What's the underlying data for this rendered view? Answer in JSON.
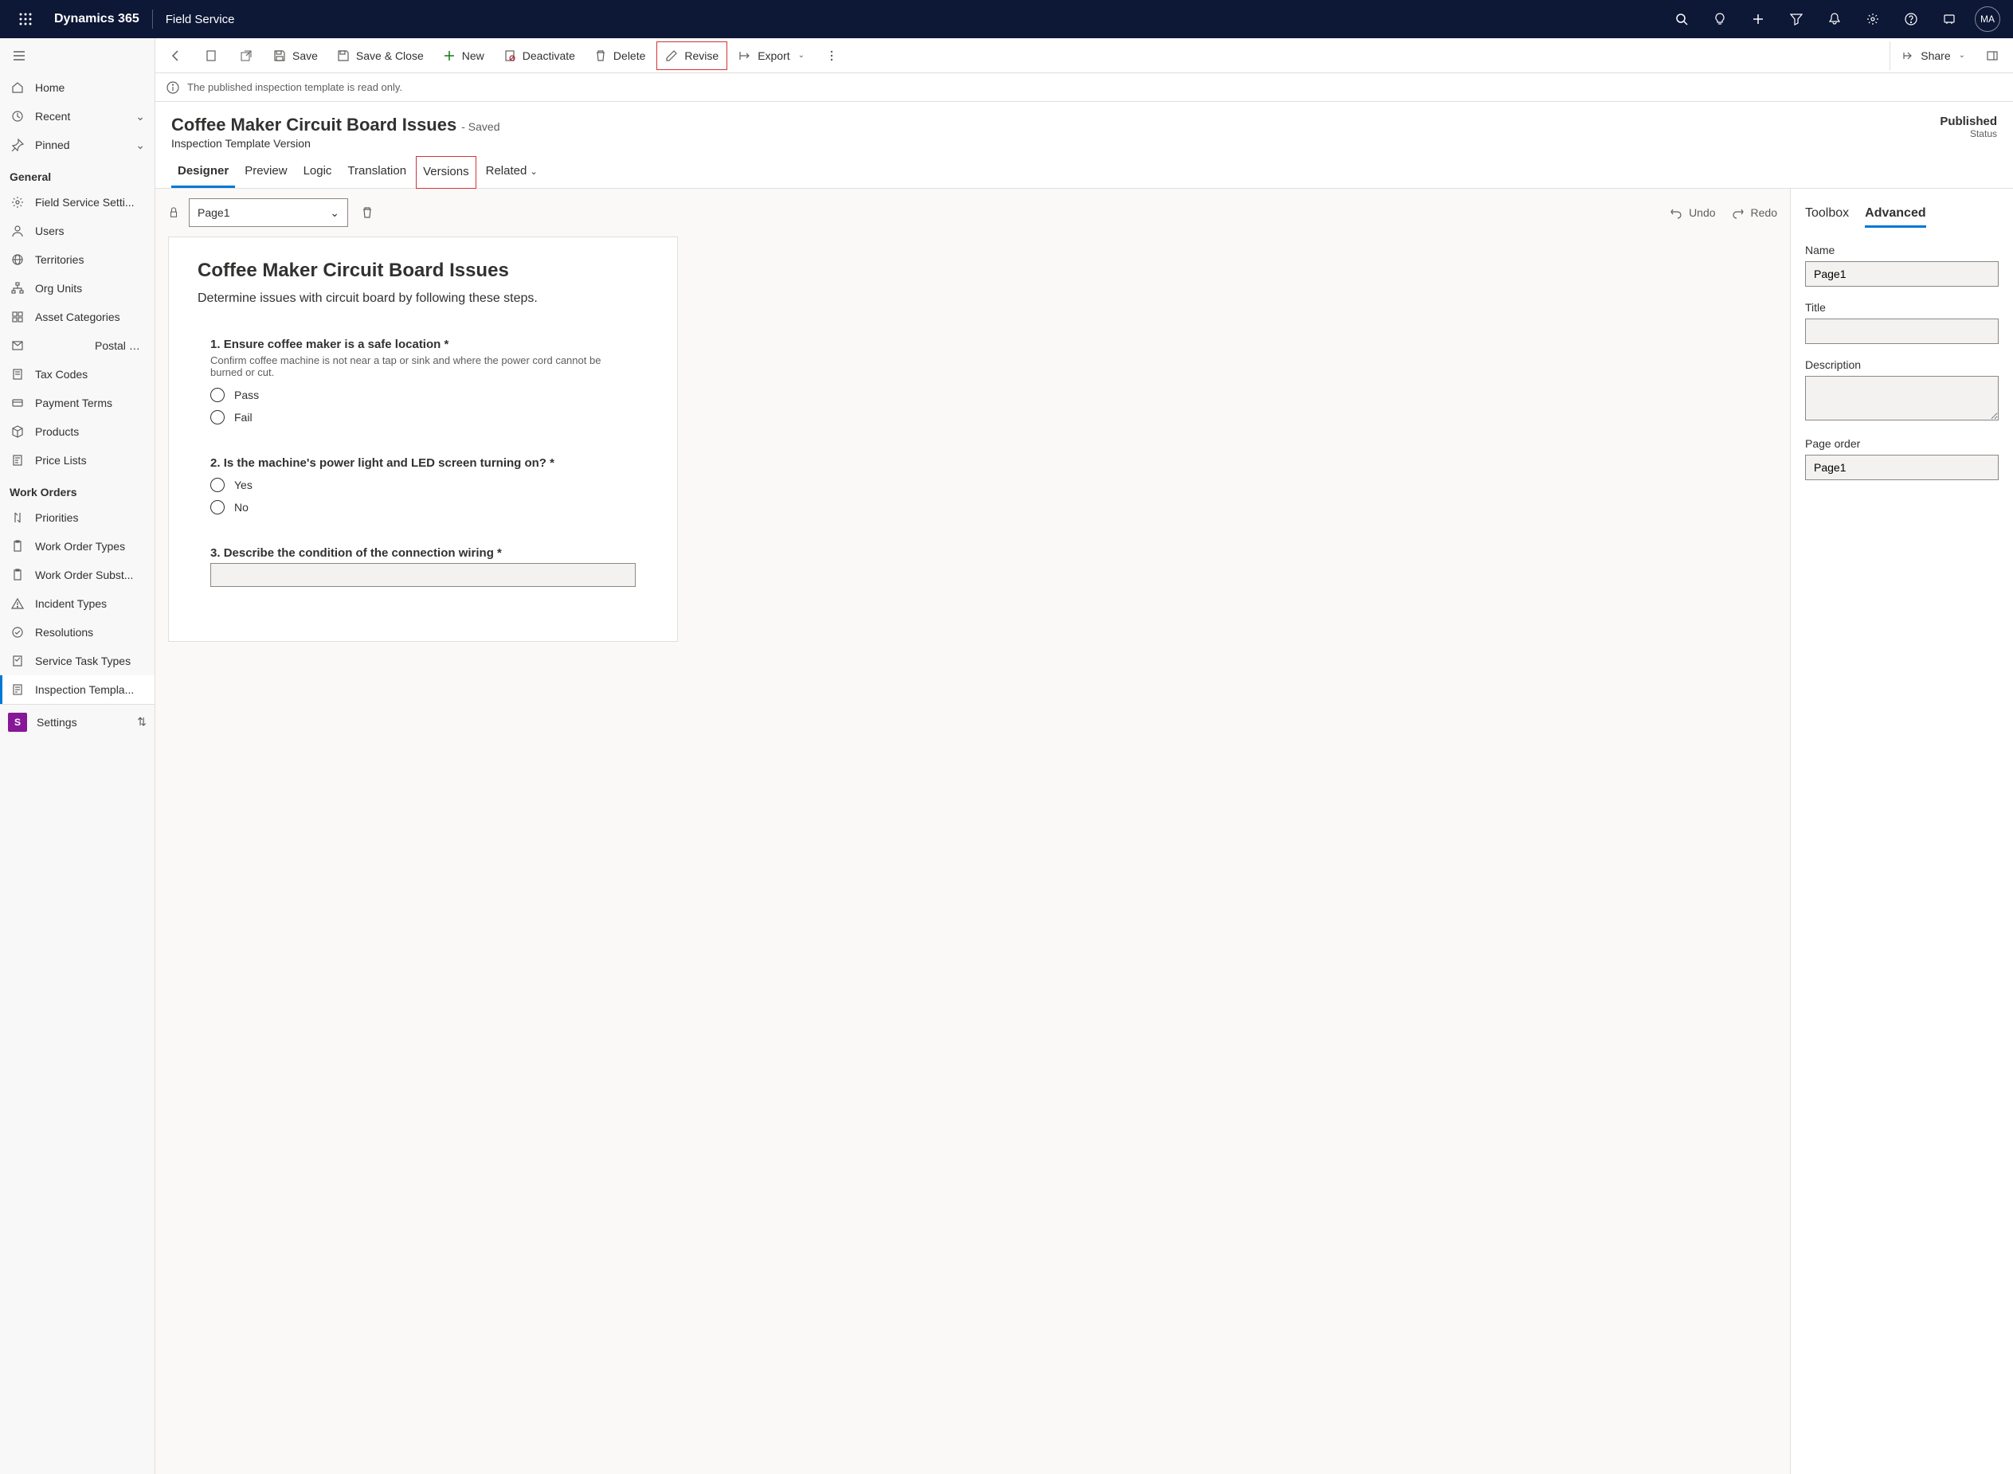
{
  "topbar": {
    "brand": "Dynamics 365",
    "app": "Field Service",
    "avatar": "MA"
  },
  "sidebar": {
    "top": [
      {
        "icon": "home",
        "label": "Home"
      },
      {
        "icon": "recent",
        "label": "Recent",
        "chev": true
      },
      {
        "icon": "pin",
        "label": "Pinned",
        "chev": true
      }
    ],
    "section1": "General",
    "general": [
      {
        "icon": "gear",
        "label": "Field Service Setti..."
      },
      {
        "icon": "user",
        "label": "Users"
      },
      {
        "icon": "globe",
        "label": "Territories"
      },
      {
        "icon": "org",
        "label": "Org Units"
      },
      {
        "icon": "asset",
        "label": "Asset Categories"
      },
      {
        "icon": "mail",
        "label": "Postal Codes"
      },
      {
        "icon": "tax",
        "label": "Tax Codes"
      },
      {
        "icon": "pay",
        "label": "Payment Terms"
      },
      {
        "icon": "prod",
        "label": "Products"
      },
      {
        "icon": "price",
        "label": "Price Lists"
      }
    ],
    "section2": "Work Orders",
    "workorders": [
      {
        "icon": "priority",
        "label": "Priorities"
      },
      {
        "icon": "wotype",
        "label": "Work Order Types"
      },
      {
        "icon": "wosub",
        "label": "Work Order Subst..."
      },
      {
        "icon": "incident",
        "label": "Incident Types"
      },
      {
        "icon": "resolution",
        "label": "Resolutions"
      },
      {
        "icon": "task",
        "label": "Service Task Types"
      },
      {
        "icon": "inspection",
        "label": "Inspection Templa...",
        "active": true
      }
    ],
    "settings": "Settings"
  },
  "cmdbar": {
    "save": "Save",
    "saveclose": "Save & Close",
    "new": "New",
    "deactivate": "Deactivate",
    "delete": "Delete",
    "revise": "Revise",
    "export": "Export",
    "share": "Share"
  },
  "infobar": "The published inspection template is read only.",
  "record": {
    "title": "Coffee Maker Circuit Board Issues",
    "saved": "- Saved",
    "subtitle": "Inspection Template Version",
    "status_value": "Published",
    "status_label": "Status"
  },
  "tabs": [
    "Designer",
    "Preview",
    "Logic",
    "Translation",
    "Versions",
    "Related"
  ],
  "designer": {
    "page_select": "Page1",
    "undo": "Undo",
    "redo": "Redo",
    "canvas_title": "Coffee Maker Circuit Board Issues",
    "canvas_desc": "Determine issues with circuit board by following these steps.",
    "questions": [
      {
        "num": "1.",
        "title": "Ensure coffee maker is a safe location",
        "req": "*",
        "hint": "Confirm coffee machine is not near a tap or sink and where the power cord cannot be burned or cut.",
        "options": [
          "Pass",
          "Fail"
        ]
      },
      {
        "num": "2.",
        "title": "Is the machine's power light and LED screen turning on?",
        "req": "*",
        "options": [
          "Yes",
          "No"
        ]
      },
      {
        "num": "3.",
        "title": "Describe the condition of the connection wiring",
        "req": "*",
        "type": "text"
      }
    ]
  },
  "rightpanel": {
    "tabs": [
      "Toolbox",
      "Advanced"
    ],
    "name_label": "Name",
    "name_value": "Page1",
    "title_label": "Title",
    "title_value": "",
    "desc_label": "Description",
    "desc_value": "",
    "order_label": "Page order",
    "order_value": "Page1"
  }
}
